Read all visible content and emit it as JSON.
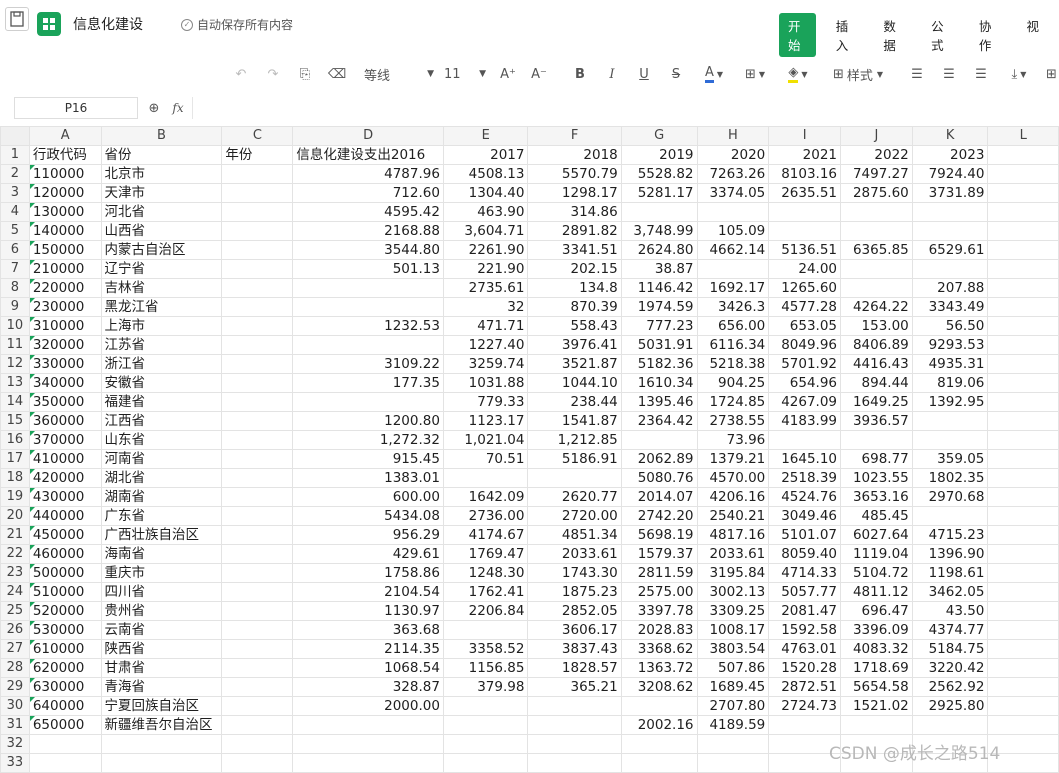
{
  "app": {
    "title": "信息化建设",
    "autosave": "自动保存所有内容",
    "menu": [
      "开始",
      "插入",
      "数据",
      "公式",
      "协作",
      "视"
    ],
    "accent": "#1aa35a"
  },
  "toolbar": {
    "font_name": "等线",
    "font_size": "11",
    "style_label": "样式",
    "font_color": "#2f6bd6",
    "fill_color": "#f0e000"
  },
  "formula": {
    "cell_ref": "P16",
    "fx_label": "fx",
    "value": ""
  },
  "columns": [
    "A",
    "B",
    "C",
    "D",
    "E",
    "F",
    "G",
    "H",
    "I",
    "J",
    "K",
    "L"
  ],
  "rows": [
    {
      "n": "1",
      "c": [
        "行政代码",
        "省份",
        "年份",
        "信息化建设支出2016",
        "2017",
        "2018",
        "2019",
        "2020",
        "2021",
        "2022",
        "2023",
        ""
      ]
    },
    {
      "n": "2",
      "c": [
        "110000",
        "北京市",
        "",
        "4787.96",
        "4508.13",
        "5570.79",
        "5528.82",
        "7263.26",
        "8103.16",
        "7497.27",
        "7924.40",
        ""
      ]
    },
    {
      "n": "3",
      "c": [
        "120000",
        "天津市",
        "",
        "712.60",
        "1304.40",
        "1298.17",
        "5281.17",
        "3374.05",
        "2635.51",
        "2875.60",
        "3731.89",
        ""
      ]
    },
    {
      "n": "4",
      "c": [
        "130000",
        "河北省",
        "",
        "4595.42",
        "463.90",
        "314.86",
        "",
        "",
        "",
        "",
        "",
        ""
      ]
    },
    {
      "n": "5",
      "c": [
        "140000",
        "山西省",
        "",
        "2168.88",
        "3,604.71",
        "2891.82",
        "3,748.99",
        "105.09",
        "",
        "",
        "",
        ""
      ]
    },
    {
      "n": "6",
      "c": [
        "150000",
        "内蒙古自治区",
        "",
        "3544.80",
        "2261.90",
        "3341.51",
        "2624.80",
        "4662.14",
        "5136.51",
        "6365.85",
        "6529.61",
        ""
      ]
    },
    {
      "n": "7",
      "c": [
        "210000",
        "辽宁省",
        "",
        "501.13",
        "221.90",
        "202.15",
        "38.87",
        "",
        "24.00",
        "",
        "",
        ""
      ]
    },
    {
      "n": "8",
      "c": [
        "220000",
        "吉林省",
        "",
        "",
        "2735.61",
        "134.8",
        "1146.42",
        "1692.17",
        "1265.60",
        "",
        "207.88",
        ""
      ]
    },
    {
      "n": "9",
      "c": [
        "230000",
        "黑龙江省",
        "",
        "",
        "32",
        "870.39",
        "1974.59",
        "3426.3",
        "4577.28",
        "4264.22",
        "3343.49",
        ""
      ]
    },
    {
      "n": "10",
      "c": [
        "310000",
        "上海市",
        "",
        "1232.53",
        "471.71",
        "558.43",
        "777.23",
        "656.00",
        "653.05",
        "153.00",
        "56.50",
        ""
      ]
    },
    {
      "n": "11",
      "c": [
        "320000",
        "江苏省",
        "",
        "",
        "1227.40",
        "3976.41",
        "5031.91",
        "6116.34",
        "8049.96",
        "8406.89",
        "9293.53",
        ""
      ]
    },
    {
      "n": "12",
      "c": [
        "330000",
        "浙江省",
        "",
        "3109.22",
        "3259.74",
        "3521.87",
        "5182.36",
        "5218.38",
        "5701.92",
        "4416.43",
        "4935.31",
        ""
      ]
    },
    {
      "n": "13",
      "c": [
        "340000",
        "安徽省",
        "",
        "177.35",
        "1031.88",
        "1044.10",
        "1610.34",
        "904.25",
        "654.96",
        "894.44",
        "819.06",
        ""
      ]
    },
    {
      "n": "14",
      "c": [
        "350000",
        "福建省",
        "",
        "",
        "779.33",
        "238.44",
        "1395.46",
        "1724.85",
        "4267.09",
        "1649.25",
        "1392.95",
        ""
      ]
    },
    {
      "n": "15",
      "c": [
        "360000",
        "江西省",
        "",
        "1200.80",
        "1123.17",
        "1541.87",
        "2364.42",
        "2738.55",
        "4183.99",
        "3936.57",
        "",
        ""
      ]
    },
    {
      "n": "16",
      "c": [
        "370000",
        "山东省",
        "",
        "1,272.32",
        "1,021.04",
        "1,212.85",
        "",
        "73.96",
        "",
        "",
        "",
        ""
      ]
    },
    {
      "n": "17",
      "c": [
        "410000",
        "河南省",
        "",
        "915.45",
        "70.51",
        "5186.91",
        "2062.89",
        "1379.21",
        "1645.10",
        "698.77",
        "359.05",
        ""
      ]
    },
    {
      "n": "18",
      "c": [
        "420000",
        "湖北省",
        "",
        "1383.01",
        "",
        "",
        "5080.76",
        "4570.00",
        "2518.39",
        "1023.55",
        "1802.35",
        ""
      ]
    },
    {
      "n": "19",
      "c": [
        "430000",
        "湖南省",
        "",
        "600.00",
        "1642.09",
        "2620.77",
        "2014.07",
        "4206.16",
        "4524.76",
        "3653.16",
        "2970.68",
        ""
      ]
    },
    {
      "n": "20",
      "c": [
        "440000",
        "广东省",
        "",
        "5434.08",
        "2736.00",
        "2720.00",
        "2742.20",
        "2540.21",
        "3049.46",
        "485.45",
        "",
        ""
      ]
    },
    {
      "n": "21",
      "c": [
        "450000",
        "广西壮族自治区",
        "",
        "956.29",
        "4174.67",
        "4851.34",
        "5698.19",
        "4817.16",
        "5101.07",
        "6027.64",
        "4715.23",
        ""
      ]
    },
    {
      "n": "22",
      "c": [
        "460000",
        "海南省",
        "",
        "429.61",
        "1769.47",
        "2033.61",
        "1579.37",
        "2033.61",
        "8059.40",
        "1119.04",
        "1396.90",
        ""
      ]
    },
    {
      "n": "23",
      "c": [
        "500000",
        "重庆市",
        "",
        "1758.86",
        "1248.30",
        "1743.30",
        "2811.59",
        "3195.84",
        "4714.33",
        "5104.72",
        "1198.61",
        ""
      ]
    },
    {
      "n": "24",
      "c": [
        "510000",
        "四川省",
        "",
        "2104.54",
        "1762.41",
        "1875.23",
        "2575.00",
        "3002.13",
        "5057.77",
        "4811.12",
        "3462.05",
        ""
      ]
    },
    {
      "n": "25",
      "c": [
        "520000",
        "贵州省",
        "",
        "1130.97",
        "2206.84",
        "2852.05",
        "3397.78",
        "3309.25",
        "2081.47",
        "696.47",
        "43.50",
        ""
      ]
    },
    {
      "n": "26",
      "c": [
        "530000",
        "云南省",
        "",
        "363.68",
        "",
        "3606.17",
        "2028.83",
        "1008.17",
        "1592.58",
        "3396.09",
        "4374.77",
        ""
      ]
    },
    {
      "n": "27",
      "c": [
        "610000",
        "陕西省",
        "",
        "2114.35",
        "3358.52",
        "3837.43",
        "3368.62",
        "3803.54",
        "4763.01",
        "4083.32",
        "5184.75",
        ""
      ]
    },
    {
      "n": "28",
      "c": [
        "620000",
        "甘肃省",
        "",
        "1068.54",
        "1156.85",
        "1828.57",
        "1363.72",
        "507.86",
        "1520.28",
        "1718.69",
        "3220.42",
        ""
      ]
    },
    {
      "n": "29",
      "c": [
        "630000",
        "青海省",
        "",
        "328.87",
        "379.98",
        "365.21",
        "3208.62",
        "1689.45",
        "2872.51",
        "5654.58",
        "2562.92",
        ""
      ]
    },
    {
      "n": "30",
      "c": [
        "640000",
        "宁夏回族自治区",
        "",
        "2000.00",
        "",
        "",
        "",
        "2707.80",
        "2724.73",
        "1521.02",
        "2925.80",
        ""
      ]
    },
    {
      "n": "31",
      "c": [
        "650000",
        "新疆维吾尔自治区",
        "",
        "",
        "",
        "",
        "2002.16",
        "4189.59",
        "",
        "",
        "",
        ""
      ]
    },
    {
      "n": "32",
      "c": [
        "",
        "",
        "",
        "",
        "",
        "",
        "",
        "",
        "",
        "",
        "",
        ""
      ]
    },
    {
      "n": "33",
      "c": [
        "",
        "",
        "",
        "",
        "",
        "",
        "",
        "",
        "",
        "",
        "",
        ""
      ]
    }
  ],
  "watermark": "CSDN @成长之路514"
}
